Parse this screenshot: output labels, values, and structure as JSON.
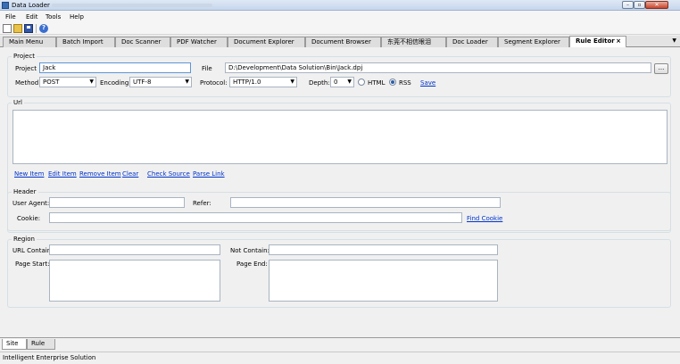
{
  "window": {
    "title": "Data Loader"
  },
  "menu": {
    "file": "File",
    "edit": "Edit",
    "tools": "Tools",
    "help": "Help"
  },
  "toolbar": {
    "help_glyph": "?"
  },
  "tabs": [
    {
      "label": "Main Menu"
    },
    {
      "label": "Batch Import"
    },
    {
      "label": "Doc Scanner"
    },
    {
      "label": "PDF Watcher"
    },
    {
      "label": "Document Explorer"
    },
    {
      "label": "Document Browser"
    },
    {
      "label": "东莞不相信眼泪"
    },
    {
      "label": "Doc Loader"
    },
    {
      "label": "Segment Explorer"
    },
    {
      "label": "Rule Editor",
      "close": "×"
    }
  ],
  "project": {
    "group_title": "Project",
    "project_label": "Project",
    "project_value": "Jack",
    "file_label": "File",
    "file_value": "D:\\Development\\Data Solution\\Bin\\Jack.dpj",
    "browse_label": "...",
    "method_label": "Method:",
    "method_value": "POST",
    "encoding_label": "Encoding:",
    "encoding_value": "UTF-8",
    "protocol_label": "Protocol:",
    "protocol_value": "HTTP/1.0",
    "depth_label": "Depth:",
    "depth_value": "0",
    "html_label": "HTML",
    "rss_label": "RSS",
    "save_label": "Save"
  },
  "url": {
    "group_title": "Url",
    "new_item": "New Item",
    "edit_item": "Edit Item",
    "remove_item": "Remove Item",
    "clear": "Clear",
    "check_source": "Check Source",
    "parse_link": "Parse Link"
  },
  "header": {
    "group_title": "Header",
    "user_agent_label": "User Agent:",
    "refer_label": "Refer:",
    "cookie_label": "Cookie:",
    "find_cookie": "Find Cookie"
  },
  "region": {
    "group_title": "Region",
    "url_contain_label": "URL Contain:",
    "not_contain_label": "Not Contain:",
    "page_start_label": "Page Start:",
    "page_end_label": "Page End:"
  },
  "bottom_tabs": {
    "site": "Site",
    "rule": "Rule"
  },
  "status": {
    "text": "Intelligent Enterprise Solution"
  }
}
